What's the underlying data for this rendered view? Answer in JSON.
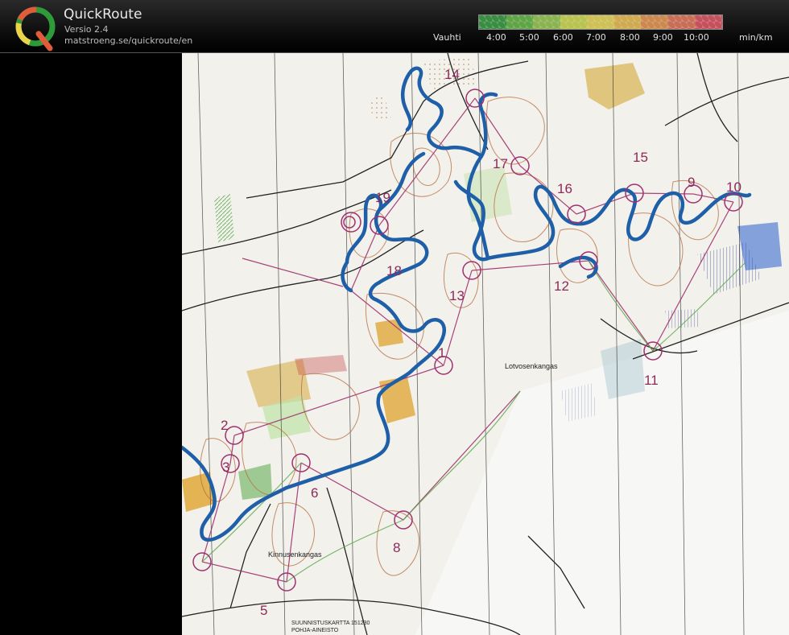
{
  "app": {
    "title": "QuickRoute",
    "version": "Versio 2.4",
    "url": "matstroeng.se/quickroute/en"
  },
  "pace_legend": {
    "label": "Vauhti",
    "unit": "min/km",
    "ticks": [
      "4:00",
      "5:00",
      "6:00",
      "7:00",
      "8:00",
      "9:00",
      "10:00"
    ],
    "colors": [
      "#3fa34a",
      "#6cbf4e",
      "#9fd05a",
      "#d6e35a",
      "#f0e060",
      "#f1c55a",
      "#ee9d58",
      "#ea7d62",
      "#e55b6a"
    ]
  },
  "map": {
    "place_names": [
      "Lotvosenkangas",
      "Kinnusenkangas"
    ],
    "footer_lines": [
      "SUUNNISTUSKARTTA 151230",
      "POHJA-AINEISTO"
    ],
    "controls": [
      {
        "number": "1"
      },
      {
        "number": "2"
      },
      {
        "number": "3"
      },
      {
        "number": "5"
      },
      {
        "number": "6"
      },
      {
        "number": "8"
      },
      {
        "number": "9"
      },
      {
        "number": "10"
      },
      {
        "number": "11"
      },
      {
        "number": "12"
      },
      {
        "number": "13"
      },
      {
        "number": "14"
      },
      {
        "number": "15"
      },
      {
        "number": "16"
      },
      {
        "number": "17"
      },
      {
        "number": "18"
      },
      {
        "number": "19"
      }
    ],
    "route_color": "#1e5fa8",
    "course_color": "#a0306e"
  }
}
